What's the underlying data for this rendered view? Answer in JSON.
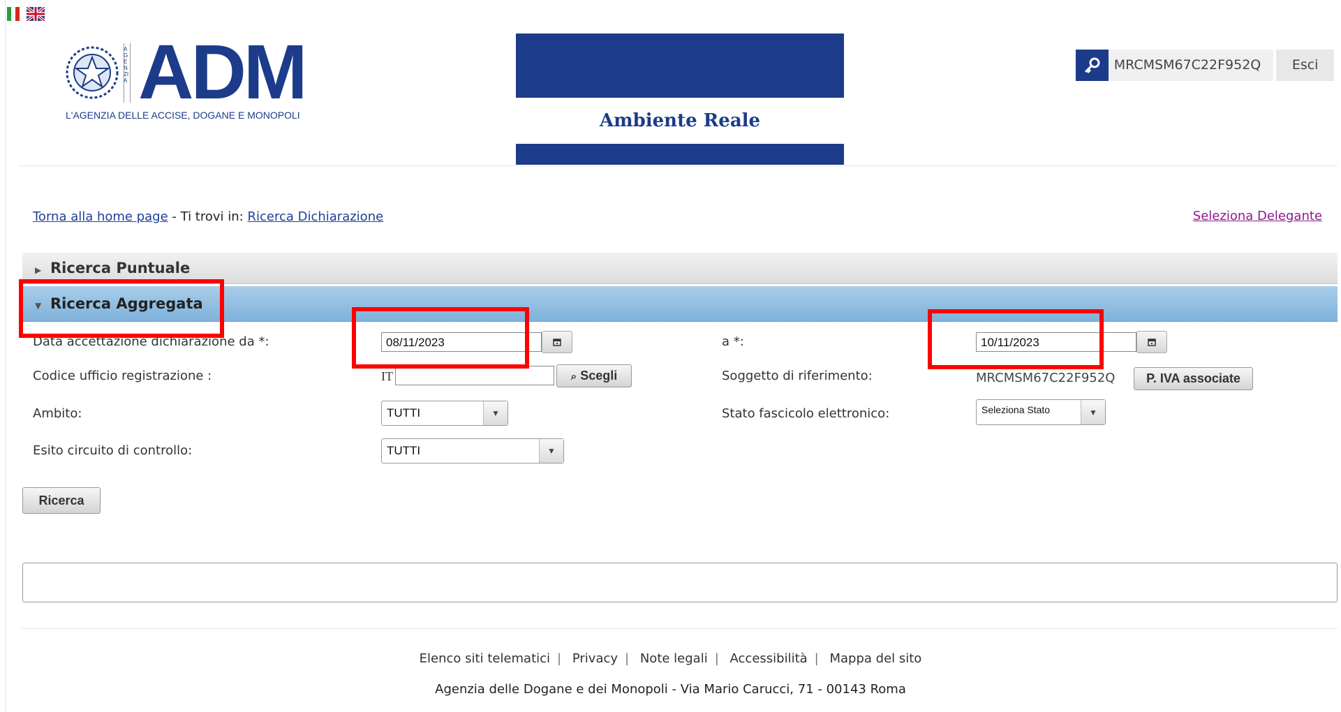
{
  "header": {
    "lang_flags": [
      "italian-flag-icon",
      "uk-flag-icon"
    ],
    "logo_title": "ADM",
    "logo_subtitle": "L'AGENZIA DELLE ACCISE, DOGANE E MONOPOLI",
    "logo_vertical_text": "AGENZIA",
    "environment_label": "Ambiente Reale",
    "user_code": "MRCMSM67C22F952Q",
    "logout_label": "Esci",
    "colors": {
      "brand_blue": "#1c3b8a"
    }
  },
  "breadcrumb": {
    "home_link": "Torna alla home page",
    "separator": "- Ti trovi in:",
    "current_link": "Ricerca Dichiarazione",
    "delegante_link": "Seleziona Delegante"
  },
  "accordion": {
    "puntuale_title": "Ricerca Puntuale",
    "aggregata_title": "Ricerca Aggregata"
  },
  "form": {
    "date_from_label": "Data accettazione dichiarazione da *:",
    "date_from_value": "08/11/2023",
    "date_to_label": "a *:",
    "date_to_value": "10/11/2023",
    "codice_ufficio_label": "Codice ufficio registrazione :",
    "codice_ufficio_prefix": "IT",
    "codice_ufficio_value": "",
    "scegli_label": "Scegli",
    "soggetto_label": "Soggetto di riferimento:",
    "soggetto_value": "MRCMSM67C22F952Q",
    "piva_label": "P. IVA associate",
    "ambito_label": "Ambito:",
    "ambito_value": "TUTTI",
    "stato_label": "Stato fascicolo elettronico:",
    "stato_value": "Seleziona Stato",
    "esito_label": "Esito circuito di controllo:",
    "esito_value": "TUTTI",
    "search_button": "Ricerca"
  },
  "footer": {
    "links": [
      "Elenco siti telematici",
      "Privacy",
      "Note legali",
      "Accessibilità",
      "Mappa del sito"
    ],
    "address": "Agenzia delle Dogane e dei Monopoli - Via Mario Carucci, 71 - 00143 Roma"
  }
}
